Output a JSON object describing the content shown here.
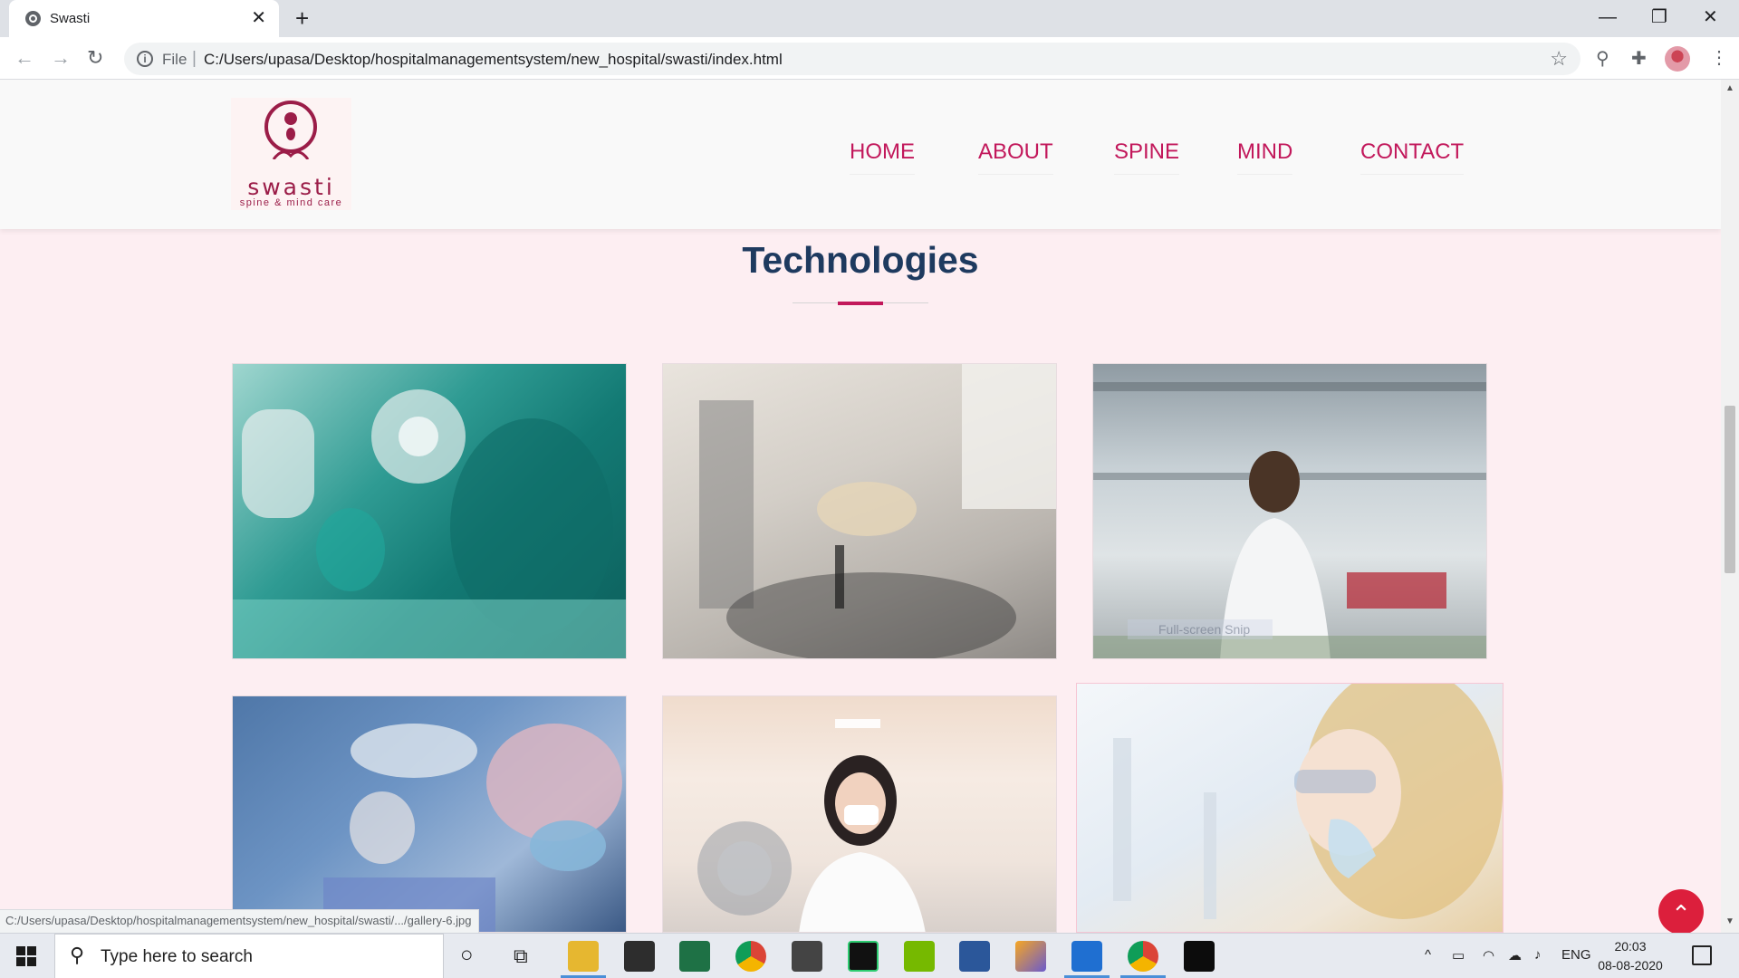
{
  "browser": {
    "tab_title": "Swasti",
    "tab_close": "✕",
    "new_tab": "+",
    "url_scheme": "File",
    "url_separator": "|",
    "url": "C:/Users/upasa/Desktop/hospitalmanagementsystem/new_hospital/swasti/index.html",
    "back_icon": "←",
    "forward_icon": "→",
    "reload_icon": "↻",
    "info_icon": "i",
    "star_icon": "☆",
    "extension_icon": "⚲",
    "puzzle_icon": "✚",
    "menu_icon": "⋮",
    "minimize": "—",
    "maximize": "❐",
    "close": "✕",
    "status_url": "C:/Users/upasa/Desktop/hospitalmanagementsystem/new_hospital/swasti/.../gallery-6.jpg"
  },
  "site": {
    "logo_text": "swasti",
    "logo_subtitle": "spine & mind care",
    "nav": {
      "home": "HOME",
      "about": "ABOUT",
      "spine": "SPINE",
      "mind": "MIND",
      "contact": "CONTACT"
    },
    "section_title": "Technologies",
    "gallery_count": 6,
    "back_to_top_icon": "⌃",
    "overlay_label": "Full-screen Snip"
  },
  "colors": {
    "accent": "#c2185b",
    "title": "#1e3a5f",
    "page_bg": "#fdeef2",
    "back_to_top": "#dc1f3c"
  },
  "taskbar": {
    "search_placeholder": "Type here to search",
    "search_icon": "⚲",
    "cortana_icon": "○",
    "taskview_icon": "⧉",
    "language": "ENG",
    "time": "20:03",
    "date": "08-08-2020",
    "tray_up": "^",
    "apps": [
      "file-explorer",
      "store",
      "excel",
      "chrome",
      "calculator",
      "pycharm",
      "nvidia",
      "word",
      "3d-viewer",
      "photos",
      "chrome-active",
      "terminal"
    ]
  }
}
